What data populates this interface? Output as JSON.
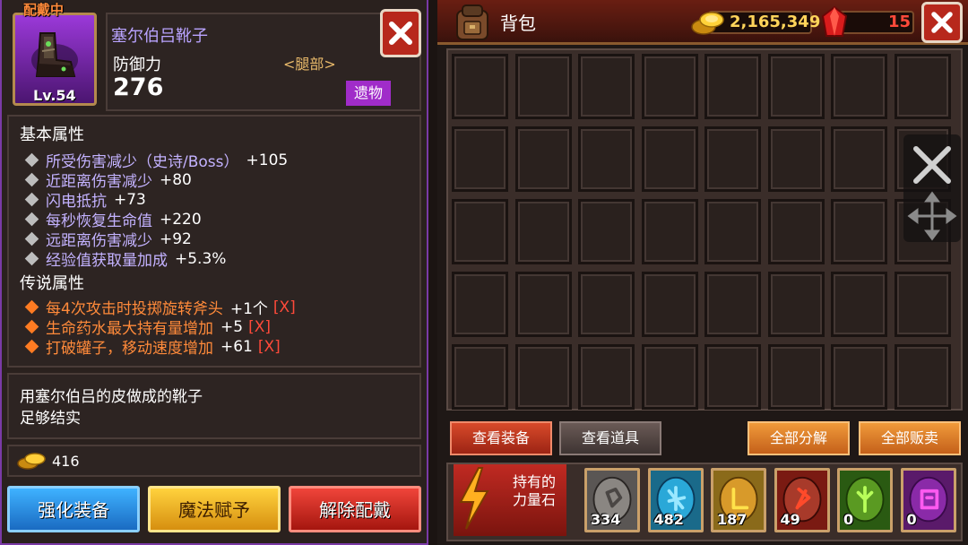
{
  "item": {
    "equipped_tag": "配戴中",
    "name": "塞尔伯吕靴子",
    "level": "Lv.54",
    "stat_label": "防御力",
    "slot": "<腿部>",
    "stat_value": "276",
    "rarity": "遗物"
  },
  "basic_attrs": {
    "title": "基本属性",
    "rows": [
      {
        "text": "所受伤害减少（史诗/Boss）",
        "value": "+105"
      },
      {
        "text": "近距离伤害减少",
        "value": "+80"
      },
      {
        "text": "闪电抵抗",
        "value": "+73"
      },
      {
        "text": "每秒恢复生命值",
        "value": "+220"
      },
      {
        "text": "远距离伤害减少",
        "value": "+92"
      },
      {
        "text": "经验值获取量加成",
        "value": "+5.3%"
      }
    ]
  },
  "legend_attrs": {
    "title": "传说属性",
    "rows": [
      {
        "text": "每4次攻击时投掷旋转斧头",
        "value": "+1个",
        "mark": "[X]"
      },
      {
        "text": "生命药水最大持有量增加",
        "value": "+5",
        "mark": "[X]"
      },
      {
        "text": "打破罐子，移动速度增加",
        "value": "+61",
        "mark": "[X]"
      }
    ]
  },
  "description": [
    "用塞尔伯吕的皮做成的靴子",
    "足够结实"
  ],
  "price": "416",
  "actions": {
    "upgrade": "强化装备",
    "enchant": "魔法赋予",
    "unequip": "解除配戴"
  },
  "inventory": {
    "title": "背包",
    "gold": "2,165,349",
    "gems": "15",
    "tabs": {
      "equipment": "查看装备",
      "items": "查看道具",
      "decompose_all": "全部分解",
      "sell_all": "全部贩卖"
    },
    "stones_label": "持有的\n力量石",
    "stones": [
      {
        "color": "grey",
        "count": "334"
      },
      {
        "color": "cyan",
        "count": "482"
      },
      {
        "color": "gold",
        "count": "187"
      },
      {
        "color": "red",
        "count": "49"
      },
      {
        "color": "green",
        "count": "0"
      },
      {
        "color": "purple",
        "count": "0"
      }
    ]
  },
  "icons": {
    "close": "close-icon",
    "move": "move-icon",
    "bag": "backpack-icon",
    "coin": "coin-icon",
    "gem": "ruby-icon",
    "bolt": "lightning-icon"
  }
}
